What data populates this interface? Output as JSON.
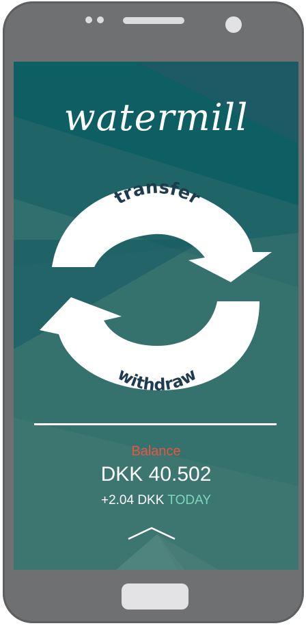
{
  "app": {
    "logo_text": "watermill"
  },
  "actions": {
    "transfer_label": "transfer",
    "withdraw_label": "withdraw"
  },
  "balance": {
    "label": "Balance",
    "value": "DKK 40.502",
    "change": "+2.04 DKK",
    "period": "TODAY"
  },
  "colors": {
    "balance_label": "#e6563f",
    "today": "#7fd6b8",
    "screen_bg": "#2b6a6b"
  },
  "icons": {
    "swipe_up": "chevron-up-icon"
  }
}
